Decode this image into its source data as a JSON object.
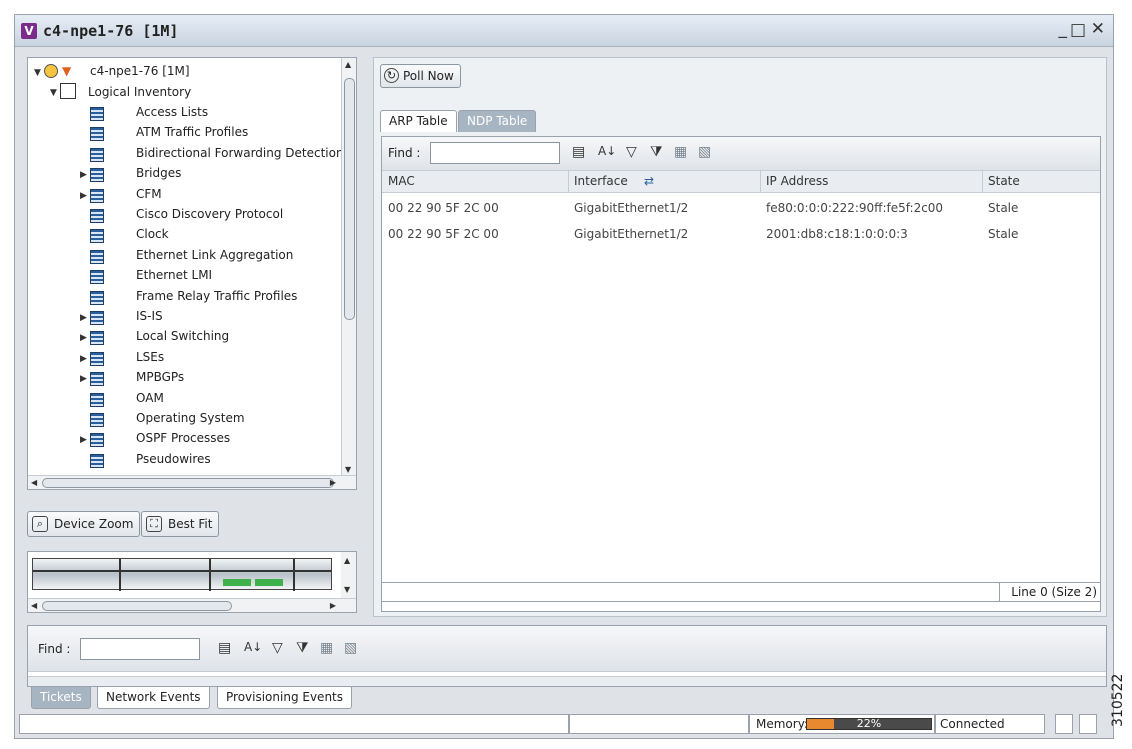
{
  "window": {
    "title": "c4-npe1-76 [1M]",
    "app_icon_letter": "V"
  },
  "tree": {
    "root": "c4-npe1-76 [1M]",
    "logical_inventory": "Logical Inventory",
    "items": [
      "Access Lists",
      "ATM Traffic Profiles",
      "Bidirectional Forwarding Detection",
      "Bridges",
      "CFM",
      "Cisco Discovery Protocol",
      "Clock",
      "Ethernet Link Aggregation",
      "Ethernet LMI",
      "Frame Relay Traffic Profiles",
      "IS-IS",
      "Local Switching",
      "LSEs",
      "MPBGPs",
      "OAM",
      "Operating System",
      "OSPF Processes",
      "Pseudowires"
    ]
  },
  "device_toolbar": {
    "device_zoom": "Device Zoom",
    "best_fit": "Best Fit"
  },
  "main": {
    "poll_now": "Poll Now",
    "tabs": [
      "ARP Table",
      "NDP Table"
    ],
    "active_tab": "NDP Table",
    "find_label": "Find :",
    "columns": [
      "MAC",
      "Interface",
      "IP Address",
      "State"
    ],
    "rows": [
      [
        "00 22 90 5F 2C 00",
        "GigabitEthernet1/2",
        "fe80:0:0:0:222:90ff:fe5f:2c00",
        "Stale"
      ],
      [
        "00 22 90 5F 2C 00",
        "GigabitEthernet1/2",
        "2001:db8:c18:1:0:0:0:3",
        "Stale"
      ]
    ],
    "line_info": "Line 0 (Size 2)"
  },
  "bottom": {
    "find_label": "Find :",
    "tabs": [
      "Tickets",
      "Network Events",
      "Provisioning Events"
    ],
    "active_tab": "Tickets"
  },
  "statusbar": {
    "memory_label": "Memory:",
    "memory_percent": "22%",
    "memory_fraction": 0.22,
    "connection": "Connected"
  },
  "figure_id": "310522"
}
